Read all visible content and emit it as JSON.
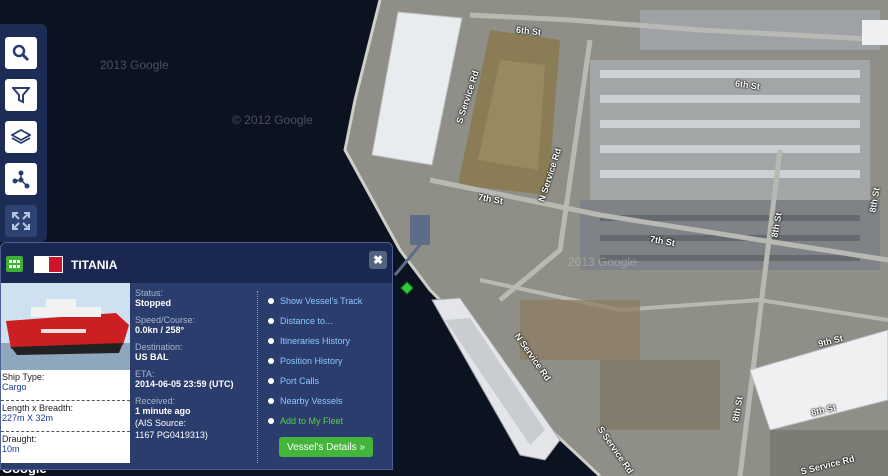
{
  "map": {
    "watermarks": [
      "2013 Google",
      "2013 Google",
      "© 2012 Google"
    ],
    "streets": [
      "6th St",
      "6th St",
      "S Service Rd",
      "N Service Rd",
      "7th St",
      "7th St",
      "8th St",
      "8th St",
      "9th St",
      "N Service Rd",
      "S Service Rd",
      "S Service Rd",
      "8th St",
      "8th St"
    ],
    "attribution": "Google"
  },
  "toolbar": {
    "buttons": [
      {
        "icon": "search-icon"
      },
      {
        "icon": "filter-icon"
      },
      {
        "icon": "layers-icon"
      },
      {
        "icon": "network-icon"
      },
      {
        "icon": "fullscreen-icon"
      }
    ]
  },
  "vessel": {
    "name": "TITANIA",
    "flag": "Malta",
    "close_label": "✖",
    "status_label": "Status:",
    "status": "Stopped",
    "speed_label": "Speed/Course:",
    "speed": "0.0kn / 258°",
    "destination_label": "Destination:",
    "destination": "US BAL",
    "eta_label": "ETA:",
    "eta": "2014-06-05 23:59 (UTC)",
    "received_label": "Received:",
    "received": "1 minute ago",
    "ais_source_line1": "(AIS Source:",
    "ais_source_line2": "1167 PG0419313)",
    "ship_type_label": "Ship Type:",
    "ship_type": "Cargo",
    "dimensions_label": "Length x Breadth:",
    "dimensions": "227m X 32m",
    "draught_label": "Draught:",
    "draught": "10m"
  },
  "links": [
    "Show Vessel's Track",
    "Distance to...",
    "Itineraries History",
    "Position History",
    "Port Calls",
    "Nearby Vessels",
    "Add to My Fleet"
  ],
  "details_button": "Vessel's Details »",
  "colors": {
    "panel_bg": "#2a3d6c",
    "header_bg": "#1a2750",
    "link": "#8cc8ff",
    "accent_green": "#44b53b"
  }
}
